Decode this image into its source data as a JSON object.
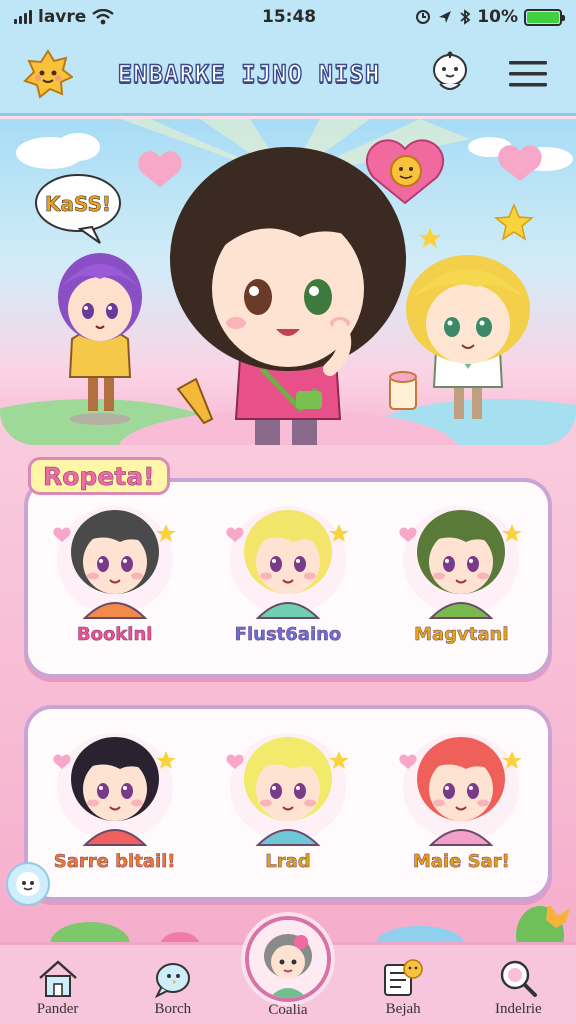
{
  "status_bar": {
    "carrier": "lavre",
    "time": "15:48",
    "battery_text": "10%",
    "battery_level": 1.0
  },
  "header": {
    "title": "ENBARKE IJNO NISH",
    "logo_icon": "sun-face-icon",
    "assistant_icon": "ghost-bot-icon",
    "menu_icon": "hamburger-menu-icon"
  },
  "hero": {
    "speech_bubble_text": "KaSS!"
  },
  "section": {
    "label": "Ropeta!"
  },
  "row1": [
    {
      "name": "Booklnl",
      "color": "#ef4f8e",
      "hair": "#4a4a4a",
      "shirt": "#f28a4a"
    },
    {
      "name": "Flust6aino",
      "color": "#6a6fd6",
      "hair": "#f3e46a",
      "shirt": "#6fcfb0"
    },
    {
      "name": "Magvtanl",
      "color": "#e3a814",
      "hair": "#5a7a3a",
      "shirt": "#79b84a"
    }
  ],
  "row2": [
    {
      "name": "Sarre bltail!",
      "color": "#f07a2a",
      "hair": "#2a2230",
      "shirt": "#f06060"
    },
    {
      "name": "Lrad",
      "color": "#d9a612",
      "hair": "#f1ea6a",
      "shirt": "#6fc7d6"
    },
    {
      "name": "Maie Sar!",
      "color": "#e8a010",
      "hair": "#f0605a",
      "shirt": "#f2a0c8"
    }
  ],
  "nav": [
    {
      "label": "Pander",
      "icon": "home-icon"
    },
    {
      "label": "Borch",
      "icon": "chat-bird-icon"
    },
    {
      "label": "Coalia",
      "icon": "avatar-icon"
    },
    {
      "label": "Bejah",
      "icon": "notes-icon"
    },
    {
      "label": "Indelrie",
      "icon": "search-icon"
    }
  ],
  "colors": {
    "header_bg": "#bfe6f7",
    "accent_pink": "#f26aa5",
    "card_border": "#c9a5d6",
    "nav_bg": "#f8c6dc",
    "battery_green": "#3fcf3f"
  }
}
